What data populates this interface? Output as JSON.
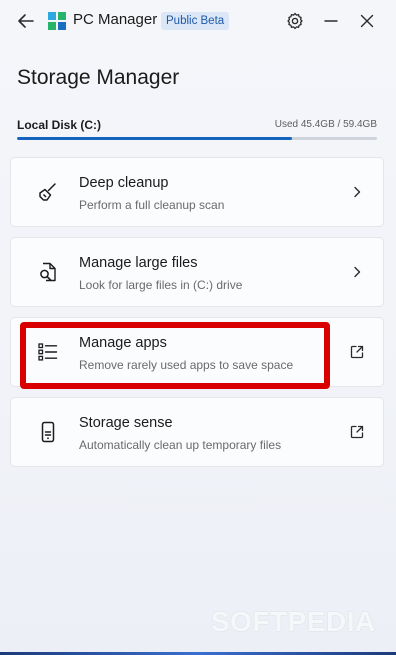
{
  "app": {
    "title": "PC Manager",
    "badge": "Public Beta"
  },
  "page": {
    "title": "Storage Manager"
  },
  "disk": {
    "label": "Local Disk (C:)",
    "usage_text": "Used 45.4GB / 59.4GB",
    "used_fraction": 0.764
  },
  "cards": [
    {
      "title": "Deep cleanup",
      "description": "Perform a full cleanup scan",
      "icon": "broom-icon",
      "action": "chevron-right-icon"
    },
    {
      "title": "Manage large files",
      "description": "Look for large files in (C:) drive",
      "icon": "file-search-icon",
      "action": "chevron-right-icon"
    },
    {
      "title": "Manage apps",
      "description": "Remove rarely used apps to save space",
      "icon": "app-list-icon",
      "action": "external-link-icon"
    },
    {
      "title": "Storage sense",
      "description": "Automatically clean up temporary files",
      "icon": "storage-device-icon",
      "action": "external-link-icon"
    }
  ],
  "colors": {
    "accent": "#1565c0",
    "highlight": "#d90000"
  },
  "watermark": "SOFTPEDIA"
}
